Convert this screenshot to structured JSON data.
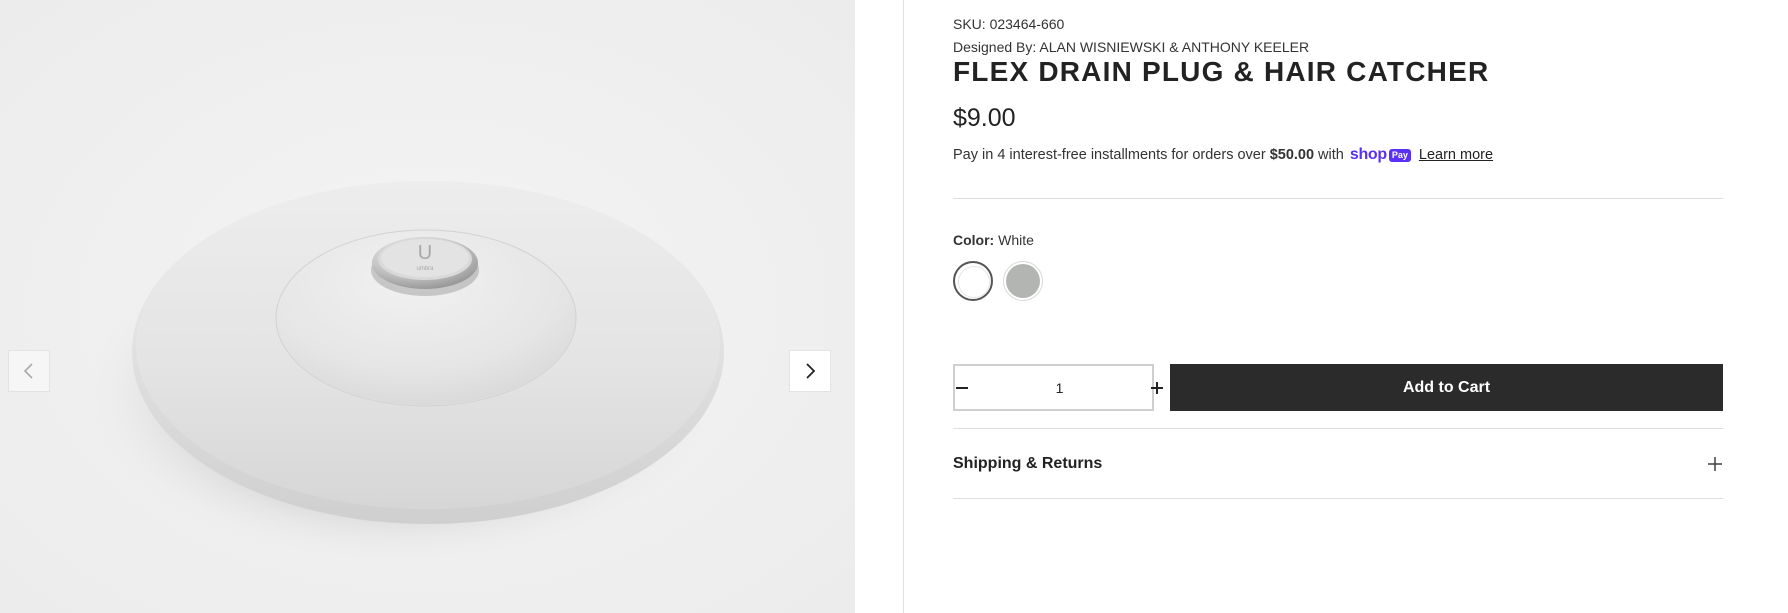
{
  "gallery": {
    "prev_icon": "chevron-left-icon",
    "next_icon": "chevron-right-icon",
    "image_alt": "Flex drain plug and hair catcher, white",
    "logo_text": "U",
    "logo_subtext": "umbra"
  },
  "product": {
    "sku": "SKU: 023464-660",
    "designer": "Designed By: ALAN WISNIEWSKI & ANTHONY KEELER",
    "title": "FLEX DRAIN PLUG & HAIR CATCHER",
    "price": "$9.00",
    "installments": {
      "prefix": "Pay in 4 interest-free installments for orders over",
      "threshold": "$50.00",
      "with": "with",
      "shop_word": "shop",
      "pay_badge": "Pay",
      "learn_more": "Learn more",
      "brand_color": "#5a31f4"
    }
  },
  "color": {
    "label": "Color:",
    "selected": "White",
    "swatches": [
      {
        "name": "White",
        "color": "#ffffff",
        "selected": true
      },
      {
        "name": "Grey",
        "color": "#b3b5b3",
        "selected": false
      }
    ]
  },
  "quantity": {
    "value": "1",
    "minus_icon": "minus-icon",
    "plus_icon": "plus-icon"
  },
  "cart": {
    "add_label": "Add to Cart",
    "button_color": "#2b2b2b"
  },
  "accordion": {
    "shipping_title": "Shipping & Returns",
    "icon": "plus-icon"
  }
}
